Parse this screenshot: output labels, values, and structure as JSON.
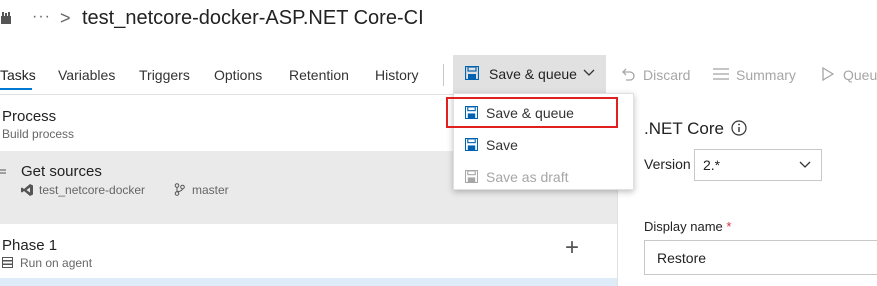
{
  "header": {
    "ellipsis": "···",
    "separator": ">",
    "title": "test_netcore-docker-ASP.NET Core-CI"
  },
  "tabs": [
    {
      "label": "Tasks",
      "active": true
    },
    {
      "label": "Variables"
    },
    {
      "label": "Triggers"
    },
    {
      "label": "Options"
    },
    {
      "label": "Retention"
    },
    {
      "label": "History"
    }
  ],
  "toolbar": {
    "save_queue_label": "Save & queue",
    "discard_label": "Discard",
    "summary_label": "Summary",
    "queue_label": "Queu"
  },
  "dropdown_menu": {
    "items": [
      {
        "label": "Save & queue",
        "icon": "save-icon",
        "highlighted": true
      },
      {
        "label": "Save",
        "icon": "save-icon"
      },
      {
        "label": "Save as draft",
        "icon": "save-icon",
        "disabled": true
      }
    ]
  },
  "process": {
    "title": "Process",
    "subtitle": "Build process"
  },
  "get_sources": {
    "title": "Get sources",
    "repo": "test_netcore-docker",
    "branch": "master"
  },
  "phase": {
    "title": "Phase 1",
    "subtitle": "Run on agent",
    "add_symbol": "+"
  },
  "details": {
    "title": ".NET Core",
    "version_label": "Version",
    "version_value": "2.*",
    "display_name_label": "Display name",
    "required_mark": "*",
    "display_name_value": "Restore"
  },
  "colors": {
    "accent": "#0078d4",
    "highlight_border": "#e0201f",
    "selected_row": "#deecf9",
    "panel_selected": "#eaeaea"
  }
}
